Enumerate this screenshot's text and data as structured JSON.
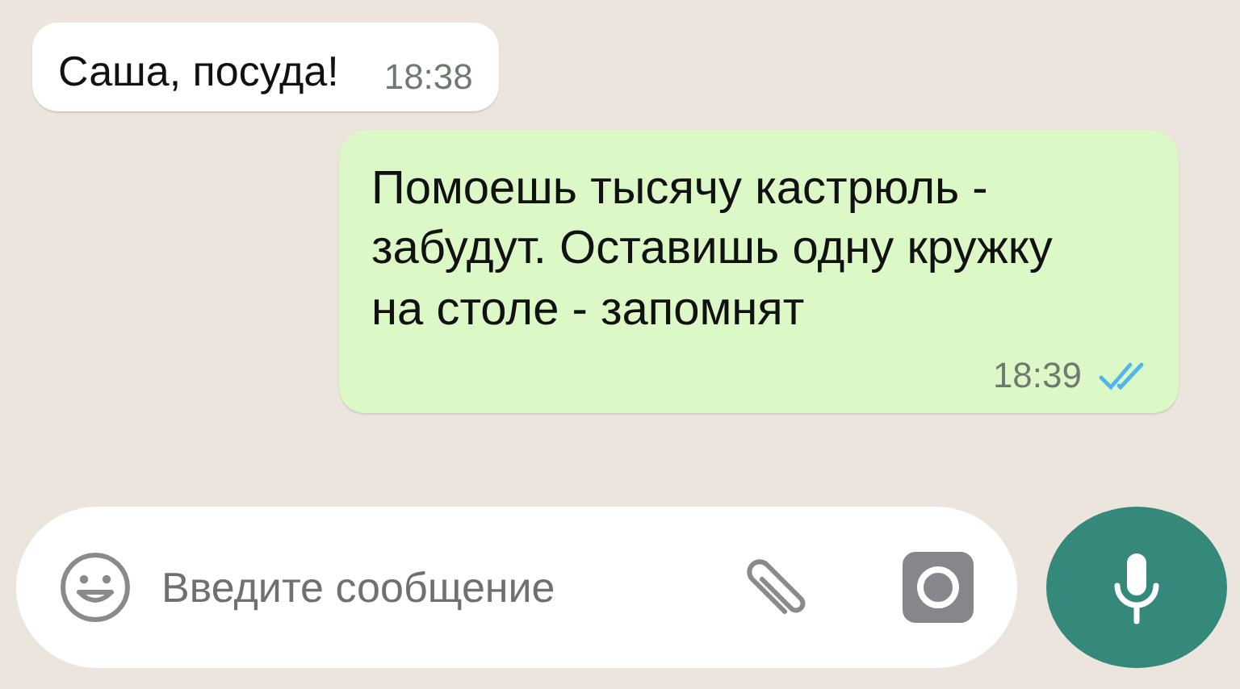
{
  "messages": [
    {
      "kind": "incoming",
      "text": "Саша, посуда!",
      "time": "18:38"
    },
    {
      "kind": "outgoing",
      "text": "Помоешь тысячу кастрюль - забудут. Оставишь одну кружку на столе - запомнят",
      "time": "18:39",
      "read": true
    }
  ],
  "composer": {
    "placeholder": "Введите сообщение"
  }
}
